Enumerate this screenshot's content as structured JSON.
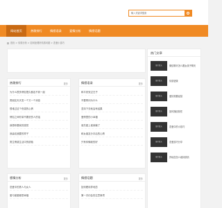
{
  "search": {
    "placeholder": "输入关键词搜索"
  },
  "nav": [
    {
      "label": "网站首页"
    },
    {
      "label": "热歌排行"
    },
    {
      "label": "情感语录"
    },
    {
      "label": "爱情分析"
    },
    {
      "label": "情感话题"
    }
  ],
  "breadcrumb": "首页 > 情感分析 > 如何处理好情感问题 > 恋爱小技巧",
  "sections": [
    {
      "title": "热歌排行",
      "more": "更多",
      "items": [
        "为什么很多情侣很久都走不到一起",
        "男朋友天天发一个又一个消息",
        "很难过这个伤感的心情",
        "情侣之间吵架不要说伤人的话",
        "我想你要我的感觉",
        "我喜欢我要的样子",
        "男生情感生活中的烦恼"
      ]
    },
    {
      "title": "情感语录",
      "more": "更多",
      "items": [
        "和平安安过日子",
        "不要再问为什么",
        "坚持下去就会有结果",
        "爱情里的小幸福",
        "谁先爱上谁就输了",
        "和女朋友分手后的心情",
        "只有你懂我的好"
      ]
    },
    {
      "title": "感情分析",
      "more": "更多",
      "items": [
        "恋爱中的男人与女人",
        "爱与被爱都是幸福"
      ]
    },
    {
      "title": "情感话题",
      "more": "更多",
      "items": [
        "如何看待异地恋",
        "第一次约会的注意事项"
      ]
    }
  ],
  "sidebar": {
    "title": "热门文章",
    "thumb_label": "图片暂无",
    "items": [
      "微信聊天怎么跟女孩子聊天",
      "情感语录",
      "爱情需要经营",
      "如何挽回前任",
      "恋爱中的小技巧",
      "恋爱技巧分享",
      "异地恋怎么维持感情"
    ]
  }
}
